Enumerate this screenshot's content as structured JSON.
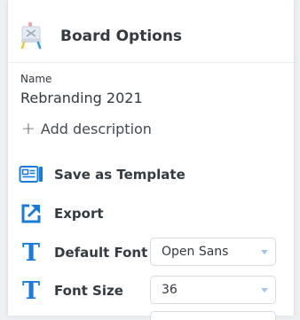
{
  "header": {
    "title": "Board Options",
    "icon": "board-easel-icon"
  },
  "board": {
    "name_label": "Name",
    "name_value": "Rebranding 2021",
    "add_description_icon": "plus-icon",
    "add_description_label": "Add description"
  },
  "menu": {
    "save_template": {
      "label": "Save as Template",
      "icon": "template-icon"
    },
    "export": {
      "label": "Export",
      "icon": "export-icon"
    },
    "default_font": {
      "label": "Default Font",
      "icon": "text-t-icon",
      "value": "Open Sans"
    },
    "font_size": {
      "label": "Font Size",
      "icon": "text-t-icon",
      "value": "36"
    }
  },
  "colors": {
    "accent": "#1c7bd6",
    "text": "#333a40",
    "border": "#d6dbe0"
  }
}
